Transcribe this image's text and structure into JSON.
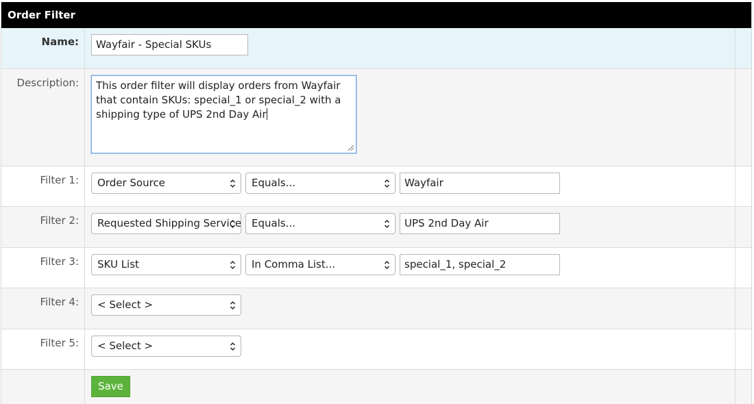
{
  "panel": {
    "title": "Order Filter"
  },
  "name": {
    "label": "Name:",
    "value": "Wayfair - Special SKUs"
  },
  "description": {
    "label": "Description:",
    "value": "This order filter will display orders from Wayfair that contain SKUs: special_1 or special_2 with a shipping type of UPS 2nd Day Air"
  },
  "filters": [
    {
      "label": "Filter 1:",
      "field": "Order Source",
      "operator": "Equals...",
      "value": "Wayfair"
    },
    {
      "label": "Filter 2:",
      "field": "Requested Shipping Service",
      "operator": "Equals...",
      "value": "UPS 2nd Day Air"
    },
    {
      "label": "Filter 3:",
      "field": "SKU List",
      "operator": "In Comma List...",
      "value": "special_1, special_2"
    },
    {
      "label": "Filter 4:",
      "field": "< Select >"
    },
    {
      "label": "Filter 5:",
      "field": "< Select >"
    }
  ],
  "save": {
    "label": "Save"
  },
  "colors": {
    "title_bg": "#000000",
    "name_row_bg": "#e7f5fa",
    "save_bg": "#5cb33c",
    "focus_border": "#79a7e0"
  }
}
